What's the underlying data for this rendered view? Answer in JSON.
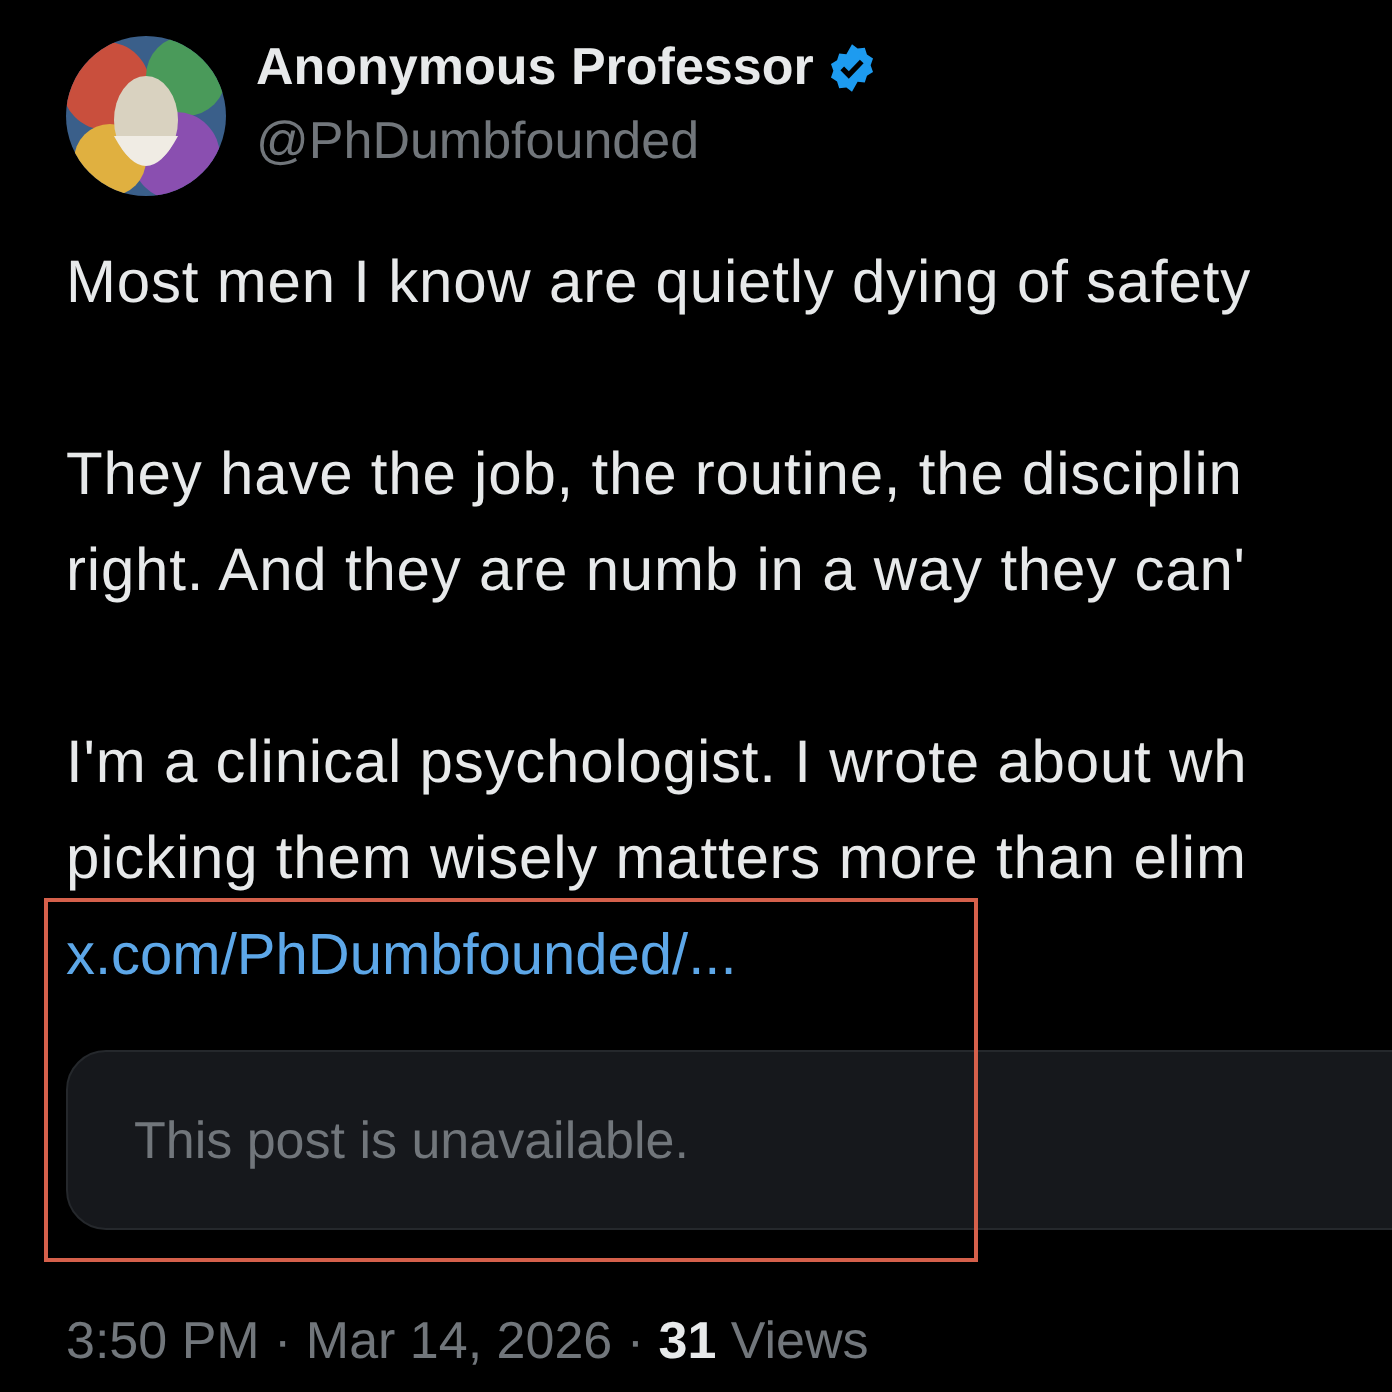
{
  "author": {
    "name": "Anonymous Professor",
    "verified": true,
    "handle": "@PhDumbfounded"
  },
  "body": {
    "paragraphs": [
      [
        "Most men I know are quietly dying of safety"
      ],
      [
        "They have the job, the routine, the disciplin",
        "right. And they are numb in a way they can'"
      ],
      [
        "I'm a clinical psychologist. I wrote about wh",
        "picking them wisely matters more than elim"
      ]
    ],
    "link": "x.com/PhDumbfounded/..."
  },
  "quote": {
    "text": "This post is unavailable."
  },
  "meta": "3:50 PM · Mar 14, 2026 · **31** Views",
  "annotation": {
    "kind": "rectangle"
  }
}
